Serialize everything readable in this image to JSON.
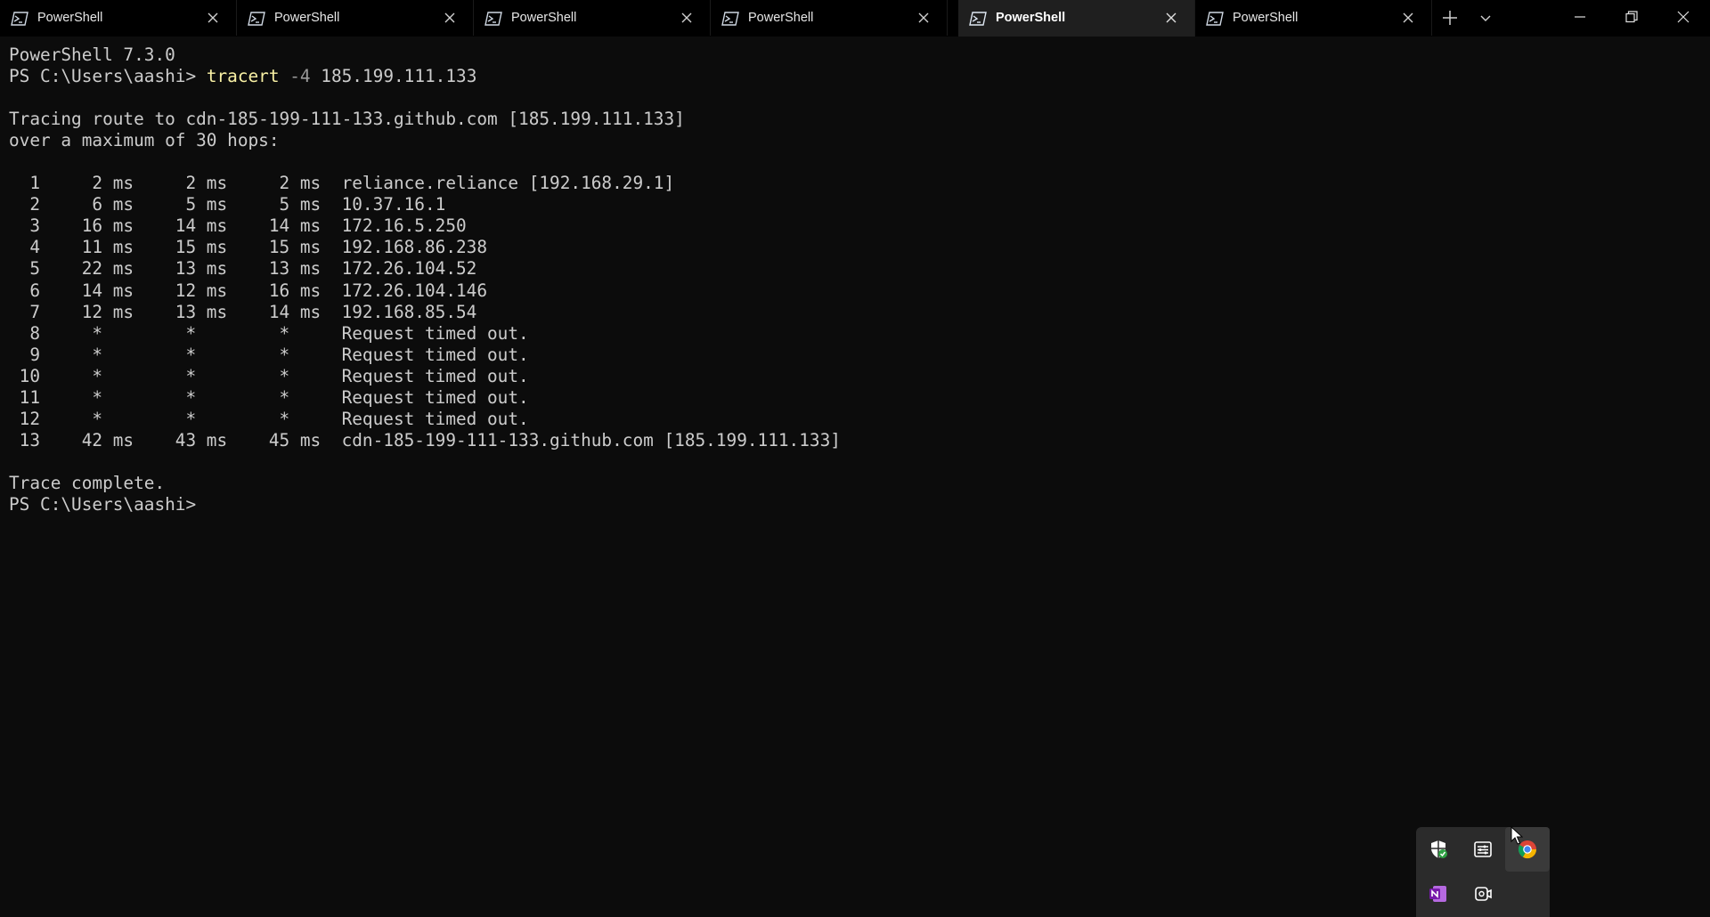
{
  "window": {
    "tabs": [
      {
        "title": "PowerShell",
        "active": false
      },
      {
        "title": "PowerShell",
        "active": false
      },
      {
        "title": "PowerShell",
        "active": false
      },
      {
        "title": "PowerShell",
        "active": false
      },
      {
        "title": "PowerShell",
        "active": true
      },
      {
        "title": "PowerShell",
        "active": false
      }
    ]
  },
  "terminal": {
    "version_line": "PowerShell 7.3.0",
    "prompt": "PS C:\\Users\\aashi> ",
    "command": "tracert",
    "param": "-4",
    "args": " 185.199.111.133",
    "blank1": "",
    "trace_header": "Tracing route to cdn-185-199-111-133.github.com [185.199.111.133]",
    "max_hops": "over a maximum of 30 hops:",
    "blank2": "",
    "hops": [
      "  1     2 ms     2 ms     2 ms  reliance.reliance [192.168.29.1]",
      "  2     6 ms     5 ms     5 ms  10.37.16.1",
      "  3    16 ms    14 ms    14 ms  172.16.5.250",
      "  4    11 ms    15 ms    15 ms  192.168.86.238",
      "  5    22 ms    13 ms    13 ms  172.26.104.52",
      "  6    14 ms    12 ms    16 ms  172.26.104.146",
      "  7    12 ms    13 ms    14 ms  192.168.85.54",
      "  8     *        *        *     Request timed out.",
      "  9     *        *        *     Request timed out.",
      " 10     *        *        *     Request timed out.",
      " 11     *        *        *     Request timed out.",
      " 12     *        *        *     Request timed out.",
      " 13    42 ms    43 ms    45 ms  cdn-185-199-111-133.github.com [185.199.111.133]"
    ],
    "blank3": "",
    "trace_complete": "Trace complete.",
    "final_prompt": "PS C:\\Users\\aashi> "
  },
  "tray": {
    "icons": [
      "security-shield-icon",
      "task-manager-icon",
      "chrome-icon",
      "onenote-icon",
      "camera-icon"
    ]
  },
  "colors": {
    "background": "#0c0c0c",
    "text": "#cccccc",
    "command": "#f9f1a5",
    "parameter": "#9a9a9a"
  }
}
